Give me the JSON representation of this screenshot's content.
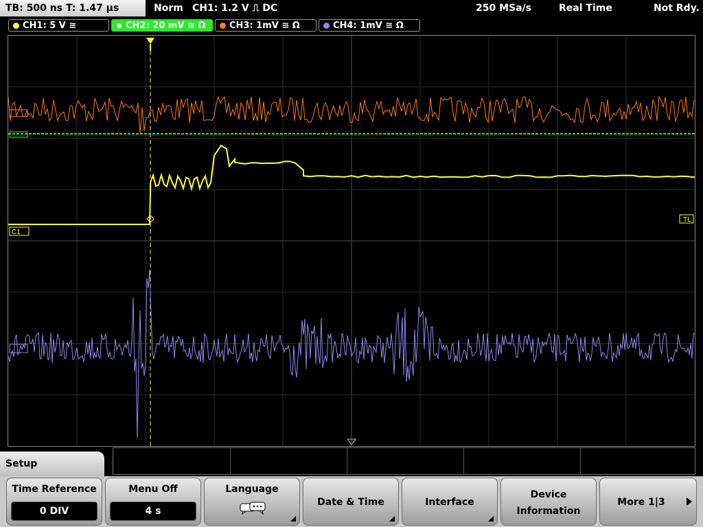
{
  "top_bar": {
    "timebase": "TB: 500 ns   T: 1.47 µs",
    "mode": "Norm",
    "trigger": "CH1: 1.2 V ⎍ DC",
    "sample_rate": "250 MSa/s",
    "acq_mode": "Real Time",
    "status": "Not Rdy."
  },
  "channels": [
    {
      "label": "CH1: 5 V ≅",
      "color": "#ffff3a",
      "active": false
    },
    {
      "label": "CH2: 20 mV ≅ Ω",
      "color": "#2ee82e",
      "active": true
    },
    {
      "label": "CH3: 1mV ≅ Ω",
      "color": "#ff7a1a",
      "active": false
    },
    {
      "label": "CH4: 1mV ≅ Ω",
      "color": "#8c8cf0",
      "active": false
    }
  ],
  "display": {
    "c1_marker": "C1",
    "tl_marker": "TL",
    "trace_colors": {
      "ch1": "#ffff3a",
      "ch2": "#2ee82e",
      "ch3": "#ff7a1a",
      "ch4": "#8c8cf0"
    }
  },
  "menu": {
    "title": "Setup",
    "softkeys": [
      {
        "label": "Time Reference",
        "value": "0 DIV"
      },
      {
        "label": "Menu Off",
        "value": "4 s"
      },
      {
        "label": "Language",
        "icon": "speech-bubbles-icon"
      },
      {
        "label": "Date & Time"
      },
      {
        "label": "Interface"
      },
      {
        "label_line1": "Device",
        "label_line2": "Information"
      },
      {
        "label": "More 1|3"
      }
    ]
  }
}
